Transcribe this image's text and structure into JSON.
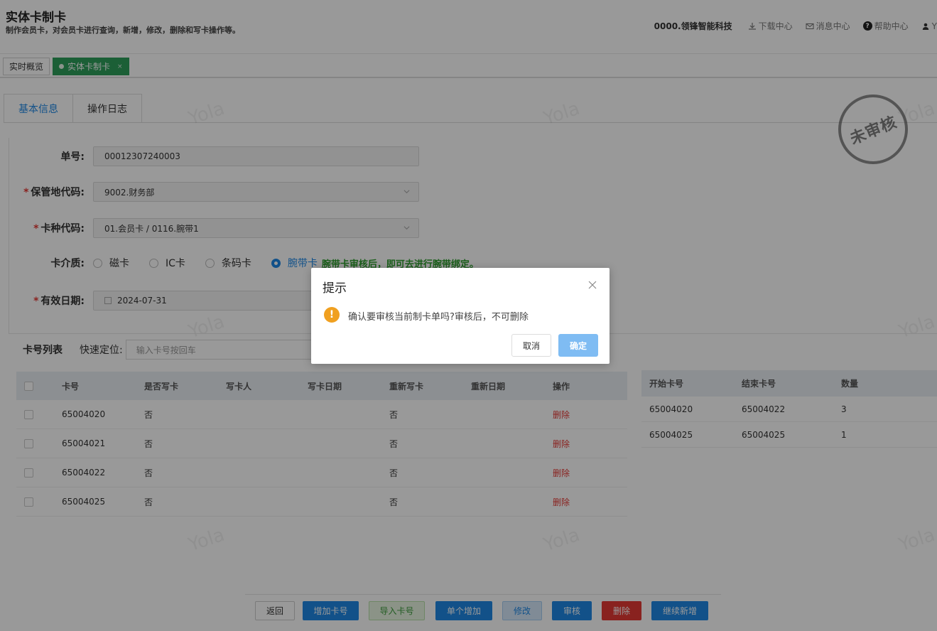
{
  "header": {
    "title": "实体卡制卡",
    "description": "制作会员卡，对会员卡进行查询，新增，修改，删除和写卡操作等。",
    "company": "0000.领锋智能科技",
    "download": "下载中心",
    "messages": "消息中心",
    "help": "帮助中心",
    "user": "Y"
  },
  "tagbar": {
    "tags": [
      {
        "label": "实时概览"
      },
      {
        "label": "实体卡制卡"
      }
    ],
    "close_glyph": "×"
  },
  "tabs": [
    {
      "label": "基本信息"
    },
    {
      "label": "操作日志"
    }
  ],
  "form": {
    "order_no": {
      "label": "单号:",
      "value": "00012307240003"
    },
    "location": {
      "label": "保管地代码:",
      "value": "9002.财务部"
    },
    "card_type": {
      "label": "卡种代码:",
      "value": "01.会员卡 / 0116.腕带1"
    },
    "medium": {
      "label": "卡介质:",
      "options": [
        "磁卡",
        "IC卡",
        "条码卡",
        "腕带卡"
      ],
      "selected": "腕带卡",
      "hint": "腕带卡审核后，即可去进行腕带绑定。"
    },
    "expiry": {
      "label": "有效日期:",
      "value": "2024-07-31"
    },
    "required_mark": "*"
  },
  "card_list": {
    "title": "卡号列表",
    "quick_label": "快速定位:",
    "quick_placeholder": "输入卡号按回车",
    "columns": [
      "卡号",
      "是否写卡",
      "写卡人",
      "写卡日期",
      "重新写卡",
      "重新日期",
      "操作"
    ],
    "rows": [
      {
        "card_no": "65004020",
        "written": "否",
        "writer": "",
        "write_date": "",
        "rewrite": "否",
        "rewrite_date": "",
        "action": "删除"
      },
      {
        "card_no": "65004021",
        "written": "否",
        "writer": "",
        "write_date": "",
        "rewrite": "否",
        "rewrite_date": "",
        "action": "删除"
      },
      {
        "card_no": "65004022",
        "written": "否",
        "writer": "",
        "write_date": "",
        "rewrite": "否",
        "rewrite_date": "",
        "action": "删除"
      },
      {
        "card_no": "65004025",
        "written": "否",
        "writer": "",
        "write_date": "",
        "rewrite": "否",
        "rewrite_date": "",
        "action": "删除"
      }
    ]
  },
  "range_table": {
    "columns": [
      "开始卡号",
      "结束卡号",
      "数量"
    ],
    "rows": [
      {
        "start": "65004020",
        "end": "65004022",
        "count": "3"
      },
      {
        "start": "65004025",
        "end": "65004025",
        "count": "1"
      }
    ]
  },
  "stamp": "未审核",
  "watermark": "Yola",
  "buttons": {
    "back": "返回",
    "add_card": "增加卡号",
    "import_card": "导入卡号",
    "single_add": "单个增加",
    "edit": "修改",
    "audit": "审核",
    "delete": "删除",
    "continue_add": "继续新增"
  },
  "dialog": {
    "title": "提示",
    "icon": "!",
    "message": "确认要审核当前制卡单吗?审核后，不可删除",
    "cancel": "取消",
    "confirm": "确定"
  },
  "colors": {
    "primary": "#1e88e5",
    "success": "#2e9e5b",
    "danger": "#e53935",
    "warning": "#f0a020"
  }
}
